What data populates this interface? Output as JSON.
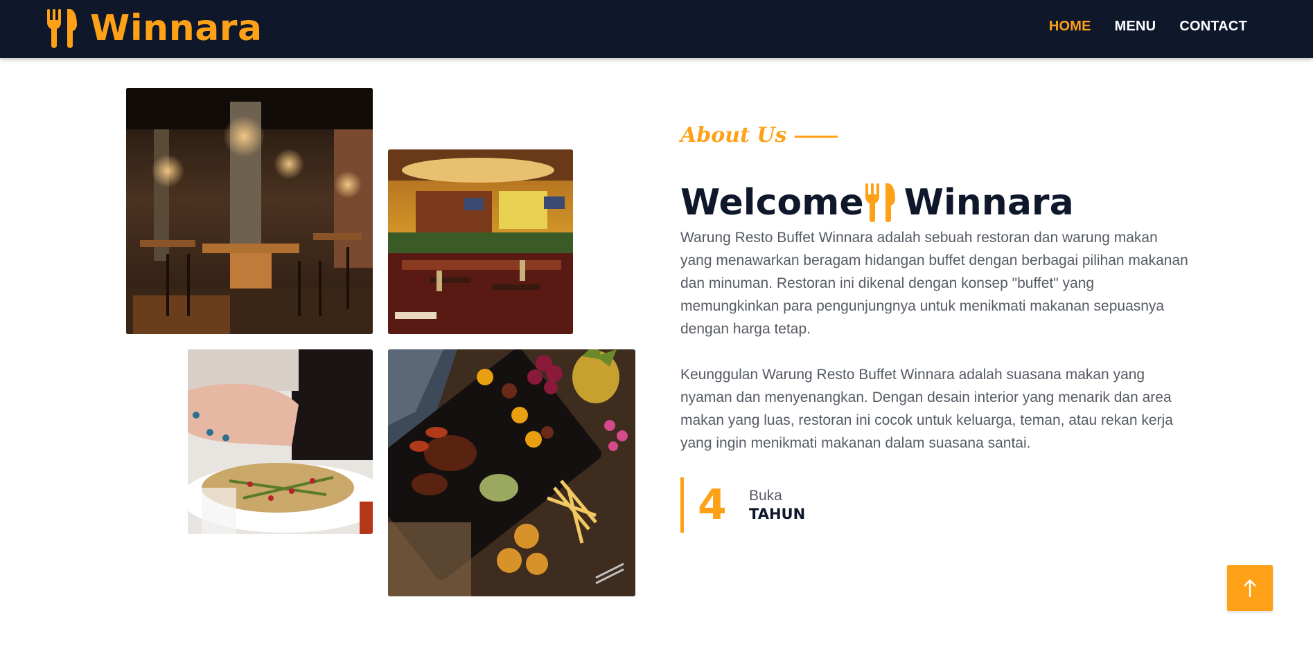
{
  "brand": {
    "name": "Winnara",
    "logo_icon": "utensils-icon"
  },
  "nav": {
    "items": [
      {
        "label": "HOME",
        "active": true
      },
      {
        "label": "MENU",
        "active": false
      },
      {
        "label": "CONTACT",
        "active": false
      }
    ]
  },
  "about": {
    "eyebrow": "About Us",
    "heading_before": "Welcome",
    "heading_icon": "utensils-icon",
    "heading_after": "Winnara",
    "paragraphs": [
      "Warung Resto Buffet Winnara adalah sebuah restoran dan warung makan yang menawarkan beragam hidangan buffet dengan berbagai pilihan makanan dan minuman. Restoran ini dikenal dengan konsep \"buffet\" yang memungkinkan para pengunjungnya untuk menikmati makanan sepuasnya dengan harga tetap.",
      "Keunggulan Warung Resto Buffet Winnara adalah suasana makan yang nyaman dan menyenangkan. Dengan desain interior yang menarik dan area makan yang luas, restoran ini cocok untuk keluarga, teman, atau rekan kerja yang ingin menikmati makanan dalam suasana santai."
    ],
    "stat": {
      "number": "4",
      "sub": "Buka",
      "label": "TAHUN"
    }
  },
  "gallery": [
    {
      "icon": "restaurant-interior-photo"
    },
    {
      "icon": "restaurant-bar-photo"
    },
    {
      "icon": "salad-plate-photo"
    },
    {
      "icon": "grilled-platter-photo"
    }
  ],
  "back_to_top": {
    "icon": "arrow-up-icon"
  },
  "colors": {
    "accent": "#fea116",
    "dark": "#0f172b",
    "text": "#555a64"
  }
}
